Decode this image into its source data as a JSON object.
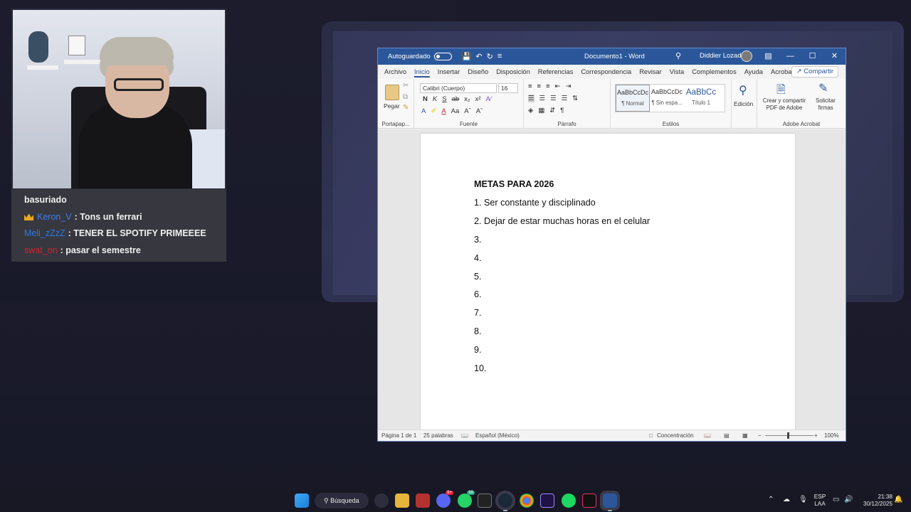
{
  "chat": {
    "header": "basuriado",
    "messages": [
      {
        "user": "Keron_V",
        "text": ": Tons un ferrari",
        "color": "#3d7fe6",
        "badge": "crown-icon"
      },
      {
        "user": "Meli_zZzZ",
        "text": ": TENER EL SPOTIFY PRIMEEEE",
        "color": "#2f79e2"
      },
      {
        "user": "swat_on",
        "text": ": pasar el semestre",
        "color": "#d8202a"
      }
    ]
  },
  "word": {
    "autosave_label": "Autoguardado",
    "doc_title": "Documento1  -  Word",
    "user_name": "Diddier Lozada",
    "tabs": [
      "Archivo",
      "Inicio",
      "Insertar",
      "Diseño",
      "Disposición",
      "Referencias",
      "Correspondencia",
      "Revisar",
      "Vista",
      "Complementos",
      "Ayuda",
      "Acrobat"
    ],
    "active_tab": "Inicio",
    "share_label": "Compartir",
    "ribbon": {
      "paste_label": "Pegar",
      "clipboard_group": "Portapap...",
      "font_name": "Calibri (Cuerpo)",
      "font_size": "16",
      "font_group": "Fuente",
      "paragraph_group": "Párrafo",
      "styles": [
        {
          "sample": "AaBbCcDc",
          "label": "¶ Normal"
        },
        {
          "sample": "AaBbCcDc",
          "label": "¶ Sin espa..."
        },
        {
          "sample": "AaBbCc",
          "label": "Título 1"
        }
      ],
      "styles_group": "Estilos",
      "edit_label": "Edición",
      "acrobat_create": "Crear y compartir PDF de Adobe",
      "acrobat_sign": "Solicitar firmas",
      "acrobat_group": "Adobe Acrobat"
    },
    "document": {
      "heading": "METAS PARA 2026",
      "items": [
        "1. Ser constante y disciplinado",
        "2. Dejar de estar muchas horas en el celular",
        "3.",
        "4.",
        "5.",
        "6.",
        "7.",
        "8.",
        "9.",
        "10."
      ]
    },
    "status": {
      "page": "Página 1 de 1",
      "words": "25 palabras",
      "language": "Español (México)",
      "focus": "Concentración",
      "zoom": "100%"
    }
  },
  "taskbar": {
    "search_label": "Búsqueda",
    "lang_line1": "ESP",
    "lang_line2": "LAA",
    "time": "21:38",
    "date": "30/12/2025",
    "badges": {
      "discord": "9+",
      "whatsapp": "99"
    }
  }
}
